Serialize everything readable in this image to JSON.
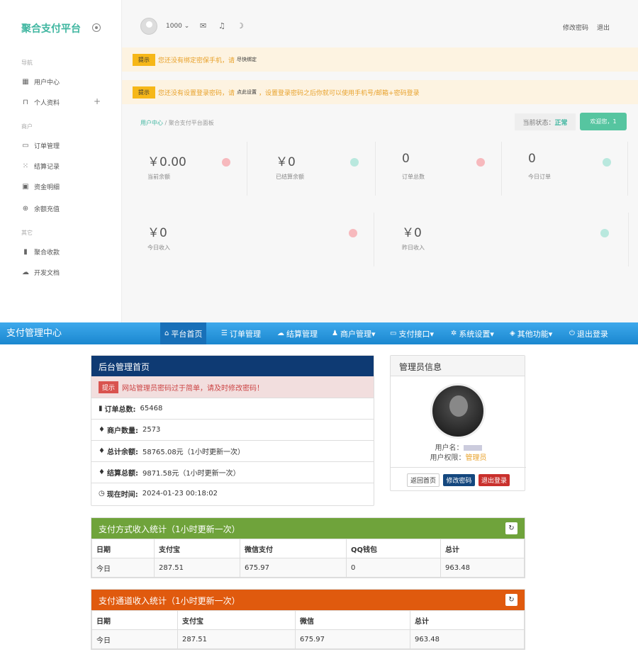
{
  "screenshot_a": {
    "sidebar": {
      "logo": "聚合支付平台",
      "sections": [
        "导航",
        "商户",
        "其它"
      ],
      "items": [
        "用户中心",
        "个人资料",
        "订单管理",
        "结算记录",
        "资金明细",
        "余额充值",
        "聚合收款",
        "开发文档"
      ]
    },
    "header": {
      "user": "1000 ⌄",
      "change_password": "修改密码",
      "logout": "退出"
    },
    "alerts": [
      {
        "tag": "提示",
        "text": "您还没有绑定密保手机，请",
        "link": "尽快绑定",
        "tail": ""
      },
      {
        "tag": "提示",
        "text": "您还没有设置登录密码，请",
        "link": "点此设置",
        "tail": "，设置登录密码之后你就可以使用手机号/邮箱+密码登录"
      }
    ],
    "breadcrumb": {
      "home": "用户中心",
      "sep": "/",
      "current": "聚合支付平台面板"
    },
    "status": {
      "label": "当前状态：",
      "value": "正常"
    },
    "welcome": "欢迎您，1",
    "stats": [
      {
        "value": "￥0.00",
        "label": "当前余额",
        "color": "#f7b9bd"
      },
      {
        "value": "￥0",
        "label": "已结算余额",
        "color": "#b9e8de"
      },
      {
        "value": "0",
        "label": "订单总数",
        "color": "#f7b9bd"
      },
      {
        "value": "0",
        "label": "今日订单",
        "color": "#b9e8de"
      },
      {
        "value": "￥0",
        "label": "今日收入",
        "color": "#f7b9bd"
      },
      {
        "value": "￥0",
        "label": "昨日收入",
        "color": "#b9e8de"
      }
    ]
  },
  "screenshot_b": {
    "nav": {
      "brand": "支付管理中心",
      "items": [
        "平台首页",
        "订单管理",
        "结算管理",
        "商户管理▾",
        "支付接口▾",
        "系统设置▾",
        "其他功能▾",
        "退出登录"
      ]
    },
    "admin_panel": {
      "title": "后台管理首页",
      "warning_tag": "提示",
      "warning": "网站管理员密码过于简单，请及时修改密码！",
      "rows": [
        {
          "label": "订单总数:",
          "value": "65468"
        },
        {
          "label": "商户数量:",
          "value": "2573"
        },
        {
          "label": "总计余额:",
          "value": "58765.08元（1小时更新一次）"
        },
        {
          "label": "结算总额:",
          "value": "9871.58元（1小时更新一次）"
        },
        {
          "label": "现在时间:",
          "value": "2024-01-23 00:18:02"
        }
      ]
    },
    "info_panel": {
      "title": "管理员信息",
      "username_label": "用户名：",
      "role_label": "用户权限：",
      "role": "管理员",
      "buttons": [
        "返回首页",
        "修改密码",
        "退出登录"
      ]
    },
    "table1": {
      "title": "支付方式收入统计（1小时更新一次）",
      "color": "#6fa33b",
      "headers": [
        "日期",
        "支付宝",
        "微信支付",
        "QQ钱包",
        "总计"
      ],
      "row": [
        "今日",
        "287.51",
        "675.97",
        "0",
        "963.48"
      ]
    },
    "table2": {
      "title": "支付通道收入统计（1小时更新一次）",
      "color": "#e05a0e",
      "headers": [
        "日期",
        "支付宝",
        "微信",
        "总计"
      ],
      "row": [
        "今日",
        "287.51",
        "675.97",
        "963.48"
      ]
    }
  }
}
